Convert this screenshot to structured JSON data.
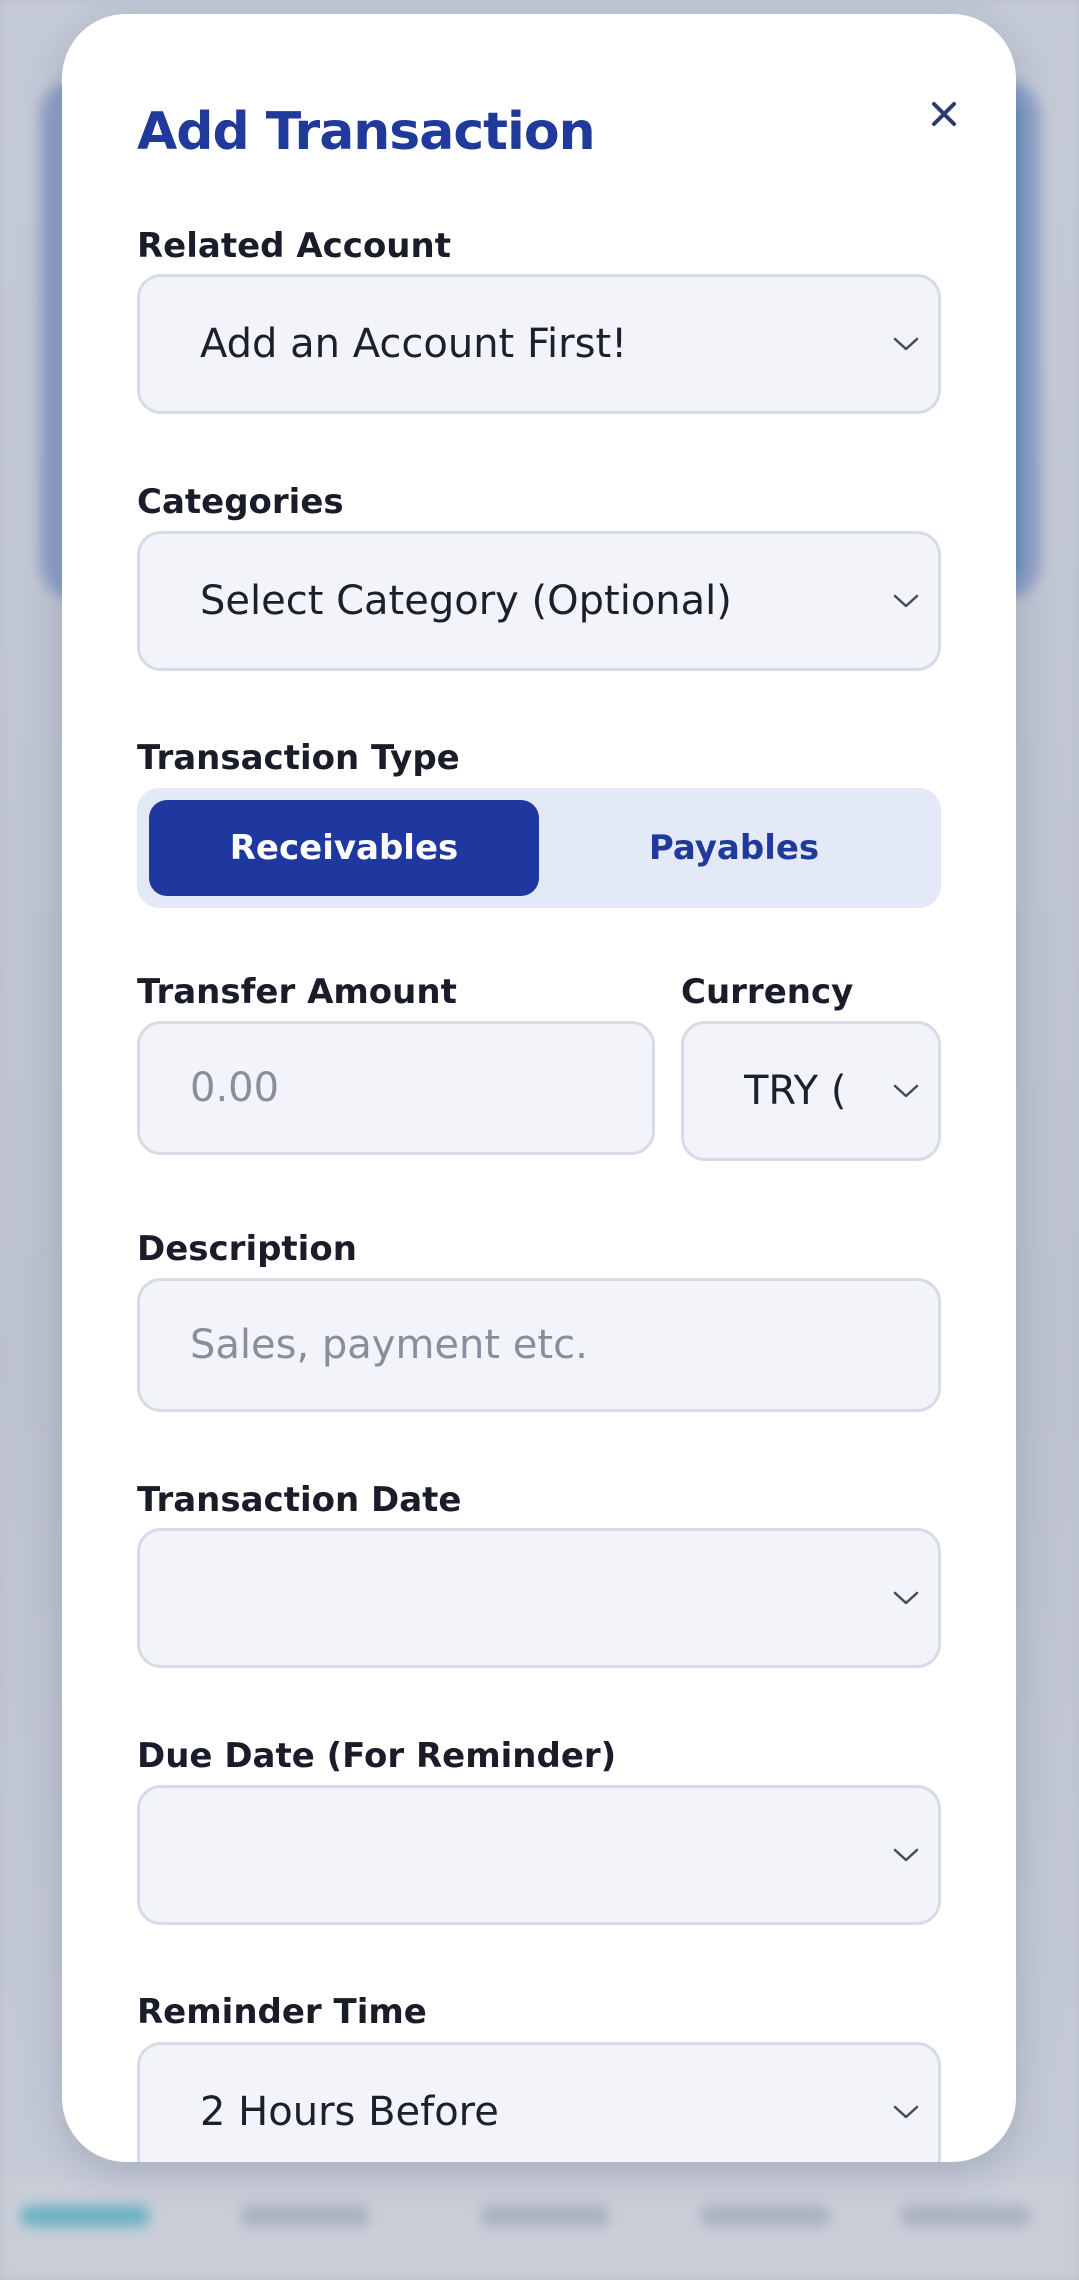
{
  "modal": {
    "title": "Add Transaction",
    "close_symbol": "×"
  },
  "related_account": {
    "label": "Related Account",
    "value": "Add an Account First!"
  },
  "categories": {
    "label": "Categories",
    "value": "Select Category (Optional)"
  },
  "transaction_type": {
    "label": "Transaction Type",
    "options": [
      "Receivables",
      "Payables"
    ],
    "selected": "Receivables"
  },
  "transfer_amount": {
    "label": "Transfer Amount",
    "placeholder": "0.00"
  },
  "currency": {
    "label": "Currency",
    "value": "TRY ("
  },
  "description": {
    "label": "Description",
    "placeholder": "Sales, payment etc."
  },
  "transaction_date": {
    "label": "Transaction Date",
    "value": ""
  },
  "due_date": {
    "label": "Due Date (For Reminder)",
    "value": ""
  },
  "reminder_time": {
    "label": "Reminder Time",
    "value": "2 Hours Before"
  },
  "colors": {
    "accent": "#1f38a0",
    "title": "#1f3a9a",
    "field_bg": "#f2f4fa",
    "segment_bg": "#e4e9f8"
  }
}
